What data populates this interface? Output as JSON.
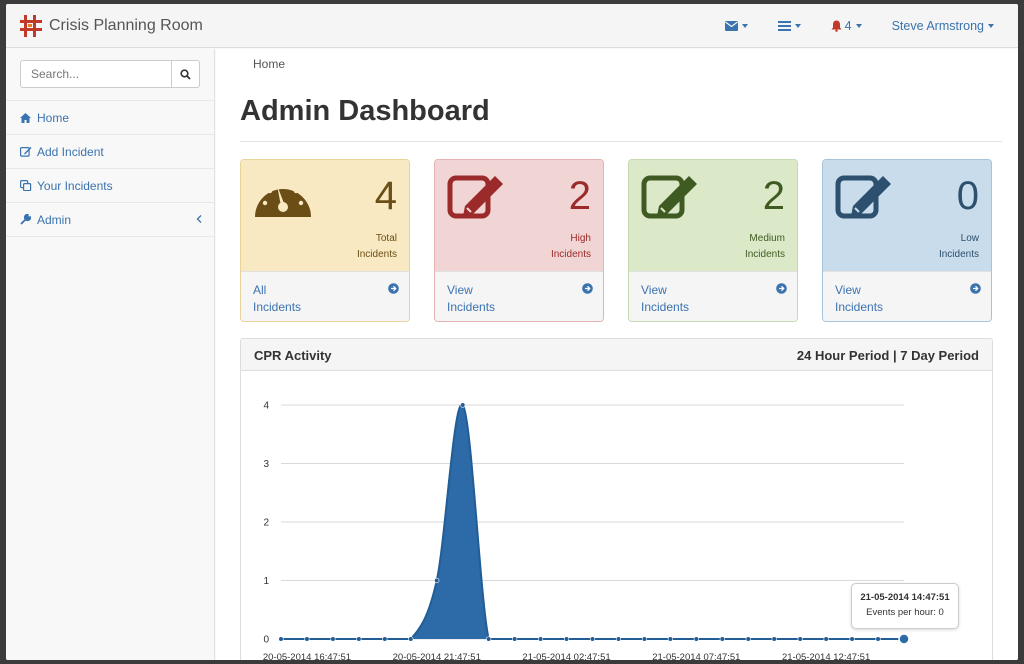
{
  "app": {
    "title": "Crisis Planning Room"
  },
  "navbar": {
    "alerts_count": "4",
    "user_name": "Steve Armstrong"
  },
  "sidebar": {
    "search_placeholder": "Search...",
    "items": [
      {
        "label": "Home",
        "icon": "home-icon"
      },
      {
        "label": "Add Incident",
        "icon": "edit-icon"
      },
      {
        "label": "Your Incidents",
        "icon": "copy-icon"
      },
      {
        "label": "Admin",
        "icon": "wrench-icon"
      }
    ]
  },
  "breadcrumb": "Home",
  "page_title": "Admin Dashboard",
  "cards": [
    {
      "count": "4",
      "label_line1": "Total",
      "label_line2": "Incidents",
      "link_line1": "All",
      "link_line2": "Incidents",
      "icon": "dashboard-icon",
      "color": "#f8e9c3"
    },
    {
      "count": "2",
      "label_line1": "High",
      "label_line2": "Incidents",
      "link_line1": "View",
      "link_line2": "Incidents",
      "icon": "edit-icon",
      "color": "#f1d4d4"
    },
    {
      "count": "2",
      "label_line1": "Medium",
      "label_line2": "Incidents",
      "link_line1": "View",
      "link_line2": "Incidents",
      "icon": "edit-icon",
      "color": "#dbe9c9"
    },
    {
      "count": "0",
      "label_line1": "Low",
      "label_line2": "Incidents",
      "link_line1": "View",
      "link_line2": "Incidents",
      "icon": "edit-icon",
      "color": "#c9dcec"
    }
  ],
  "panel": {
    "title": "CPR Activity",
    "periods": "24 Hour Period | 7 Day Period"
  },
  "tooltip": {
    "time": "21-05-2014 14:47:51",
    "text": "Events per hour: 0"
  },
  "chart_data": {
    "type": "area",
    "y_ticks": [
      0,
      1,
      2,
      3,
      4
    ],
    "ylim": [
      0,
      4
    ],
    "x_tick_labels": [
      "20-05-2014 16:47:51",
      "20-05-2014 21:47:51",
      "21-05-2014 02:47:51",
      "21-05-2014 07:47:51",
      "21-05-2014 12:47:51"
    ],
    "values": [
      0,
      0,
      0,
      0,
      0,
      0,
      1,
      4,
      0,
      0,
      0,
      0,
      0,
      0,
      0,
      0,
      0,
      0,
      0,
      0,
      0,
      0,
      0,
      0,
      0
    ],
    "color": "#2c6aa8",
    "grid": true
  }
}
